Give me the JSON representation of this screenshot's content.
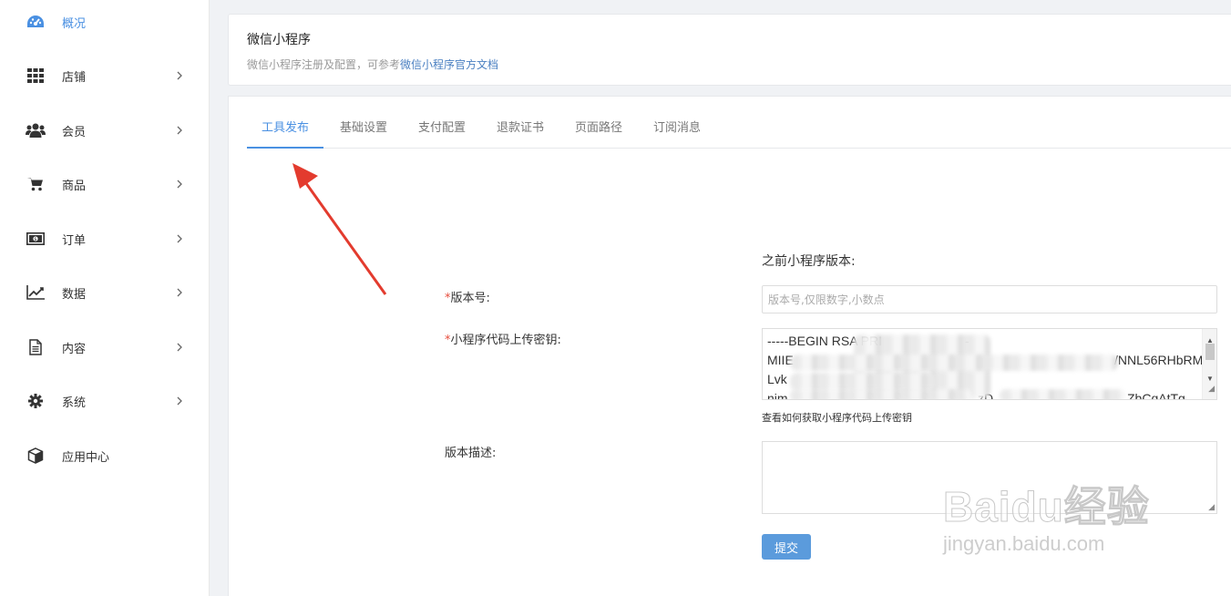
{
  "sidebar": {
    "items": [
      {
        "label": "概况",
        "icon": "dashboard-icon",
        "active": true
      },
      {
        "label": "店铺",
        "icon": "grid-icon"
      },
      {
        "label": "会员",
        "icon": "users-icon"
      },
      {
        "label": "商品",
        "icon": "cart-icon"
      },
      {
        "label": "订单",
        "icon": "money-icon"
      },
      {
        "label": "数据",
        "icon": "chart-line-icon"
      },
      {
        "label": "内容",
        "icon": "document-icon"
      },
      {
        "label": "系统",
        "icon": "gear-icon"
      },
      {
        "label": "应用中心",
        "icon": "cube-icon"
      }
    ],
    "accent": "#4a90e2"
  },
  "header": {
    "title": "微信小程序",
    "subtitle": "微信小程序注册及配置，可参考",
    "doc_link": "微信小程序官方文档"
  },
  "tabs": [
    {
      "label": "工具发布",
      "active": true
    },
    {
      "label": "基础设置"
    },
    {
      "label": "支付配置"
    },
    {
      "label": "退款证书"
    },
    {
      "label": "页面路径"
    },
    {
      "label": "订阅消息"
    }
  ],
  "form": {
    "prev_version_label": "之前小程序版本:",
    "version_label": "版本号:",
    "version_placeholder": "版本号,仅限数字,小数点",
    "key_label": "小程序代码上传密钥:",
    "key_lines": [
      "-----BEGIN RSA PRI",
      "MIIE",
      "Lvk",
      "njm"
    ],
    "key_lines_right": [
      "-",
      "/NNL56RHbRM",
      "",
      "zD",
      "ZbCqAtTg"
    ],
    "key_help": "查看如何获取小程序代码上传密钥",
    "desc_label": "版本描述:",
    "required_mark": "*",
    "submit_label": "提交"
  },
  "watermark": {
    "main": "Baidu经验",
    "sub": "jingyan.baidu.com"
  }
}
